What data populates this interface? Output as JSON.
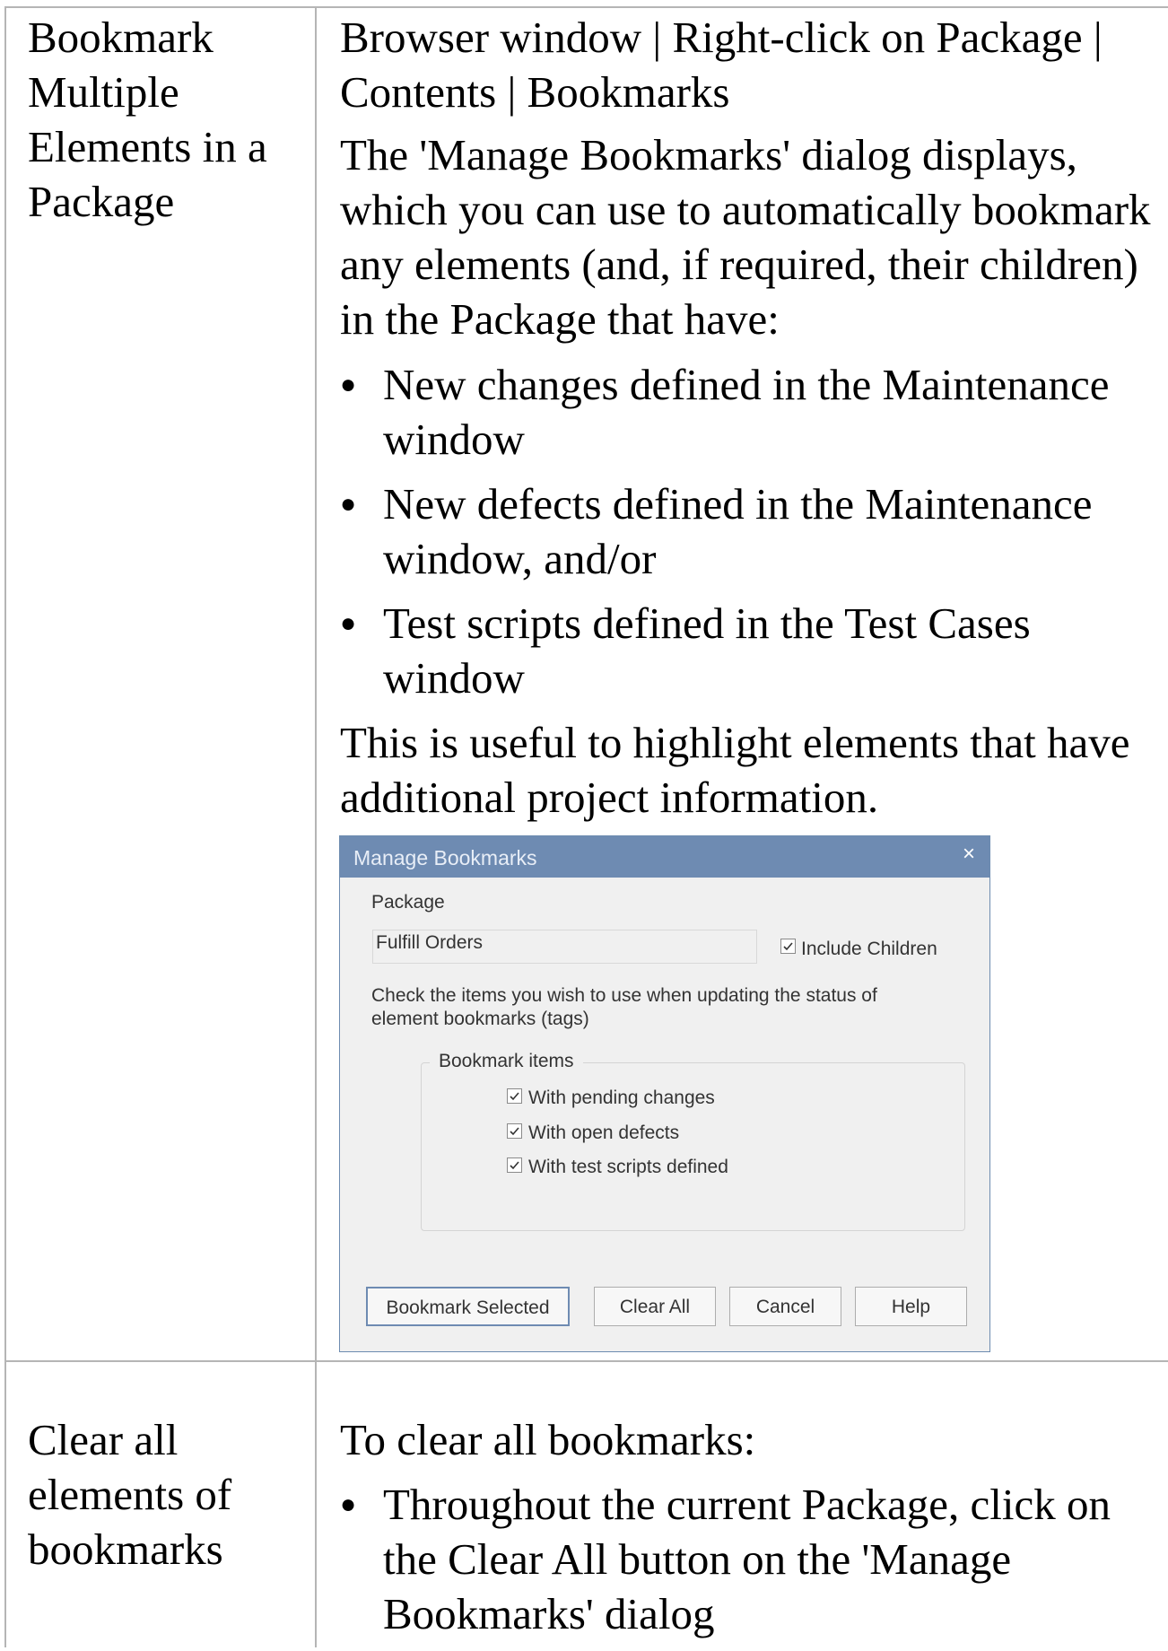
{
  "row1": {
    "left_text": "Bookmark Multiple Elements in a Package",
    "path": "Browser window | Right-click on Package | Contents | Bookmarks",
    "intro": "The 'Manage Bookmarks' dialog displays, which you can use to automatically bookmark any elements (and, if required, their children) in the Package that have:",
    "bullets": [
      "New changes defined in the Maintenance window",
      "New defects defined in the Maintenance window, and/or",
      "Test scripts defined in the Test Cases window"
    ],
    "outro": "This is useful to highlight elements that have additional project information."
  },
  "dialog": {
    "title": "Manage Bookmarks",
    "close": "×",
    "package_label": "Package",
    "package_value": "Fulfill Orders",
    "include_children": "Include Children",
    "include_children_checked": true,
    "instructions": "Check the items you wish to use when updating the status of element bookmarks (tags)",
    "group_title": "Bookmark items",
    "items": [
      {
        "label": "With pending changes",
        "checked": true
      },
      {
        "label": "With open defects",
        "checked": true
      },
      {
        "label": "With test scripts defined",
        "checked": true
      }
    ],
    "buttons": {
      "bookmark_selected": "Bookmark Selected",
      "clear_all": "Clear All",
      "cancel": "Cancel",
      "help": "Help"
    }
  },
  "row2": {
    "left_text": "Clear all elements of bookmarks",
    "intro": "To clear all bookmarks:",
    "bullets": [
      "Throughout the current Package, click on the Clear All button on the 'Manage Bookmarks' dialog"
    ]
  }
}
